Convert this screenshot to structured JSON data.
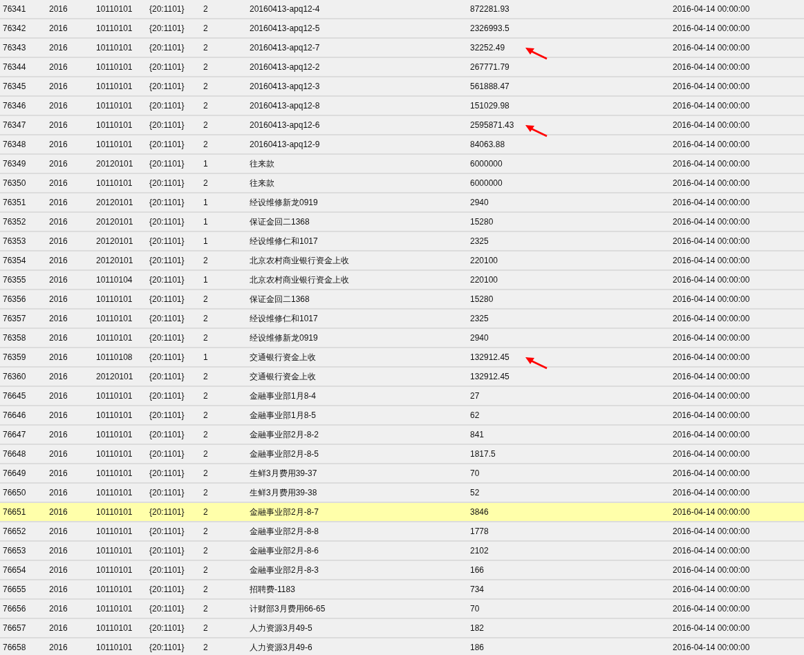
{
  "rows": [
    {
      "cells": [
        "76341",
        "2016",
        "10110101",
        "{20:1101}",
        "2",
        "20160413-apq12-4",
        "872281.93",
        "2016-04-14 00:00:00"
      ],
      "selected": false,
      "marked": false
    },
    {
      "cells": [
        "76342",
        "2016",
        "10110101",
        "{20:1101}",
        "2",
        "20160413-apq12-5",
        "2326993.5",
        "2016-04-14 00:00:00"
      ],
      "selected": false,
      "marked": false
    },
    {
      "cells": [
        "76343",
        "2016",
        "10110101",
        "{20:1101}",
        "2",
        "20160413-apq12-7",
        "32252.49",
        "2016-04-14 00:00:00"
      ],
      "selected": false,
      "marked": true
    },
    {
      "cells": [
        "76344",
        "2016",
        "10110101",
        "{20:1101}",
        "2",
        "20160413-apq12-2",
        "267771.79",
        "2016-04-14 00:00:00"
      ],
      "selected": false,
      "marked": false
    },
    {
      "cells": [
        "76345",
        "2016",
        "10110101",
        "{20:1101}",
        "2",
        "20160413-apq12-3",
        "561888.47",
        "2016-04-14 00:00:00"
      ],
      "selected": false,
      "marked": false
    },
    {
      "cells": [
        "76346",
        "2016",
        "10110101",
        "{20:1101}",
        "2",
        "20160413-apq12-8",
        "151029.98",
        "2016-04-14 00:00:00"
      ],
      "selected": false,
      "marked": false
    },
    {
      "cells": [
        "76347",
        "2016",
        "10110101",
        "{20:1101}",
        "2",
        "20160413-apq12-6",
        "2595871.43",
        "2016-04-14 00:00:00"
      ],
      "selected": false,
      "marked": true
    },
    {
      "cells": [
        "76348",
        "2016",
        "10110101",
        "{20:1101}",
        "2",
        "20160413-apq12-9",
        "84063.88",
        "2016-04-14 00:00:00"
      ],
      "selected": false,
      "marked": false
    },
    {
      "cells": [
        "76349",
        "2016",
        "20120101",
        "{20:1101}",
        "1",
        "往来款",
        "6000000",
        "2016-04-14 00:00:00"
      ],
      "selected": false,
      "marked": false
    },
    {
      "cells": [
        "76350",
        "2016",
        "10110101",
        "{20:1101}",
        "2",
        "往来款",
        "6000000",
        "2016-04-14 00:00:00"
      ],
      "selected": false,
      "marked": false
    },
    {
      "cells": [
        "76351",
        "2016",
        "20120101",
        "{20:1101}",
        "1",
        "经设维修新龙0919",
        "2940",
        "2016-04-14 00:00:00"
      ],
      "selected": false,
      "marked": false
    },
    {
      "cells": [
        "76352",
        "2016",
        "20120101",
        "{20:1101}",
        "1",
        "保证金回二1368",
        "15280",
        "2016-04-14 00:00:00"
      ],
      "selected": false,
      "marked": false
    },
    {
      "cells": [
        "76353",
        "2016",
        "20120101",
        "{20:1101}",
        "1",
        "经设维修仁和1017",
        "2325",
        "2016-04-14 00:00:00"
      ],
      "selected": false,
      "marked": false
    },
    {
      "cells": [
        "76354",
        "2016",
        "20120101",
        "{20:1101}",
        "2",
        "北京农村商业银行资金上收",
        "220100",
        "2016-04-14 00:00:00"
      ],
      "selected": false,
      "marked": false
    },
    {
      "cells": [
        "76355",
        "2016",
        "10110104",
        "{20:1101}",
        "1",
        "北京农村商业银行资金上收",
        "220100",
        "2016-04-14 00:00:00"
      ],
      "selected": false,
      "marked": false
    },
    {
      "cells": [
        "76356",
        "2016",
        "10110101",
        "{20:1101}",
        "2",
        "保证金回二1368",
        "15280",
        "2016-04-14 00:00:00"
      ],
      "selected": false,
      "marked": false
    },
    {
      "cells": [
        "76357",
        "2016",
        "10110101",
        "{20:1101}",
        "2",
        "经设维修仁和1017",
        "2325",
        "2016-04-14 00:00:00"
      ],
      "selected": false,
      "marked": false
    },
    {
      "cells": [
        "76358",
        "2016",
        "10110101",
        "{20:1101}",
        "2",
        "经设维修新龙0919",
        "2940",
        "2016-04-14 00:00:00"
      ],
      "selected": false,
      "marked": false
    },
    {
      "cells": [
        "76359",
        "2016",
        "10110108",
        "{20:1101}",
        "1",
        "交通银行资金上收",
        "132912.45",
        "2016-04-14 00:00:00"
      ],
      "selected": false,
      "marked": true
    },
    {
      "cells": [
        "76360",
        "2016",
        "20120101",
        "{20:1101}",
        "2",
        "交通银行资金上收",
        "132912.45",
        "2016-04-14 00:00:00"
      ],
      "selected": false,
      "marked": false
    },
    {
      "cells": [
        "76645",
        "2016",
        "10110101",
        "{20:1101}",
        "2",
        "金融事业部1月8-4",
        "27",
        "2016-04-14 00:00:00"
      ],
      "selected": false,
      "marked": false
    },
    {
      "cells": [
        "76646",
        "2016",
        "10110101",
        "{20:1101}",
        "2",
        "金融事业部1月8-5",
        "62",
        "2016-04-14 00:00:00"
      ],
      "selected": false,
      "marked": false
    },
    {
      "cells": [
        "76647",
        "2016",
        "10110101",
        "{20:1101}",
        "2",
        "金融事业部2月-8-2",
        "841",
        "2016-04-14 00:00:00"
      ],
      "selected": false,
      "marked": false
    },
    {
      "cells": [
        "76648",
        "2016",
        "10110101",
        "{20:1101}",
        "2",
        "金融事业部2月-8-5",
        "1817.5",
        "2016-04-14 00:00:00"
      ],
      "selected": false,
      "marked": false
    },
    {
      "cells": [
        "76649",
        "2016",
        "10110101",
        "{20:1101}",
        "2",
        "生鲜3月费用39-37",
        "70",
        "2016-04-14 00:00:00"
      ],
      "selected": false,
      "marked": false
    },
    {
      "cells": [
        "76650",
        "2016",
        "10110101",
        "{20:1101}",
        "2",
        "生鲜3月费用39-38",
        "52",
        "2016-04-14 00:00:00"
      ],
      "selected": false,
      "marked": false
    },
    {
      "cells": [
        "76651",
        "2016",
        "10110101",
        "{20:1101}",
        "2",
        "金融事业部2月-8-7",
        "3846",
        "2016-04-14 00:00:00"
      ],
      "selected": true,
      "marked": false
    },
    {
      "cells": [
        "76652",
        "2016",
        "10110101",
        "{20:1101}",
        "2",
        "金融事业部2月-8-8",
        "1778",
        "2016-04-14 00:00:00"
      ],
      "selected": false,
      "marked": false
    },
    {
      "cells": [
        "76653",
        "2016",
        "10110101",
        "{20:1101}",
        "2",
        "金融事业部2月-8-6",
        "2102",
        "2016-04-14 00:00:00"
      ],
      "selected": false,
      "marked": false
    },
    {
      "cells": [
        "76654",
        "2016",
        "10110101",
        "{20:1101}",
        "2",
        "金融事业部2月-8-3",
        "166",
        "2016-04-14 00:00:00"
      ],
      "selected": false,
      "marked": false
    },
    {
      "cells": [
        "76655",
        "2016",
        "10110101",
        "{20:1101}",
        "2",
        "招聘费-1183",
        "734",
        "2016-04-14 00:00:00"
      ],
      "selected": false,
      "marked": false
    },
    {
      "cells": [
        "76656",
        "2016",
        "10110101",
        "{20:1101}",
        "2",
        "计财部3月费用66-65",
        "70",
        "2016-04-14 00:00:00"
      ],
      "selected": false,
      "marked": false
    },
    {
      "cells": [
        "76657",
        "2016",
        "10110101",
        "{20:1101}",
        "2",
        "人力资源3月49-5",
        "182",
        "2016-04-14 00:00:00"
      ],
      "selected": false,
      "marked": false
    },
    {
      "cells": [
        "76658",
        "2016",
        "10110101",
        "{20:1101}",
        "2",
        "人力资源3月49-6",
        "186",
        "2016-04-14 00:00:00"
      ],
      "selected": false,
      "marked": false
    }
  ]
}
